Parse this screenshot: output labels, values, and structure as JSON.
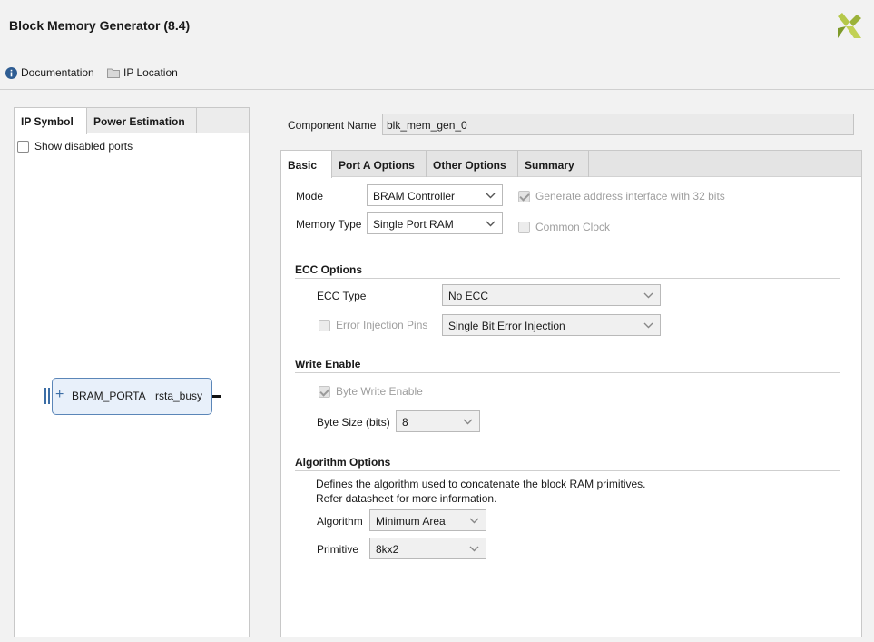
{
  "header": {
    "title": "Block Memory Generator (8.4)",
    "documentation": "Documentation",
    "ip_location": "IP Location"
  },
  "left": {
    "tabs": [
      "IP Symbol",
      "Power Estimation"
    ],
    "show_disabled_ports": "Show disabled ports",
    "symbol": {
      "port_a": "BRAM_PORTA",
      "busy": "rsta_busy"
    }
  },
  "component": {
    "label": "Component Name",
    "value": "blk_mem_gen_0"
  },
  "tabs": [
    "Basic",
    "Port A Options",
    "Other Options",
    "Summary"
  ],
  "basic": {
    "mode_label": "Mode",
    "mode_value": "BRAM Controller",
    "memtype_label": "Memory Type",
    "memtype_value": "Single Port RAM",
    "gen_addr": "Generate address interface with 32 bits",
    "common_clock": "Common Clock"
  },
  "ecc": {
    "title": "ECC Options",
    "type_label": "ECC Type",
    "type_value": "No ECC",
    "err_inj_label": "Error Injection Pins",
    "err_inj_value": "Single Bit Error Injection"
  },
  "write_enable": {
    "title": "Write Enable",
    "byte_write": "Byte Write Enable",
    "byte_size_label": "Byte Size (bits)",
    "byte_size_value": "8"
  },
  "algorithm": {
    "title": "Algorithm Options",
    "desc1": "Defines the algorithm used to concatenate the block RAM primitives.",
    "desc2": "Refer datasheet for more information.",
    "algo_label": "Algorithm",
    "algo_value": "Minimum Area",
    "prim_label": "Primitive",
    "prim_value": "8kx2"
  },
  "colors": {
    "accent": "#3c6ea6",
    "logo_light": "#b5c84a",
    "logo_dark": "#7e9a2a"
  }
}
